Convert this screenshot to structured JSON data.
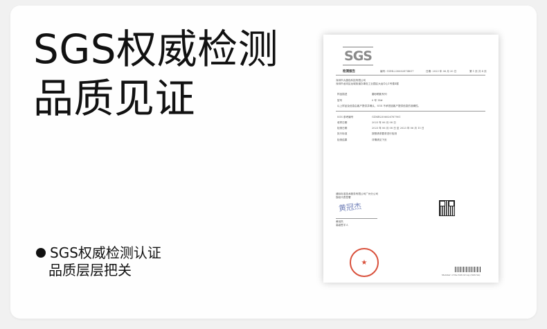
{
  "headline": {
    "line1": "SGS权威检测",
    "line2": "品质见证"
  },
  "features": {
    "line1": "SGS权威检测认证",
    "line2": "品质层层把关"
  },
  "certificate": {
    "logo_text": "SGS",
    "report_title": "检测报告",
    "report_no": "编号: GZHL2306028748O7",
    "date": "日期: 2023 年 06 月 20 日",
    "page": "第 1 页 共 4 页",
    "client_line1": "深圳市大魔色科技有限公司",
    "client_line2": "深圳市龙岗区龙城街道办事处工业园区大运中心1号楼4楼",
    "field_sample_name": "样品描述",
    "val_sample_name": "磨砂眼影系列",
    "field_model": "型号",
    "val_model": "0 号 14#",
    "info_line": "以上样品及信息由客户提供并确认，SGS 不承担因客户提供信息的准确性。",
    "field_sgs_no": "SGS 参考编号",
    "val_sgs_no": "GZMR2306026767901",
    "field_receive_date": "收样日期",
    "val_receive_date": "2023 年 06 月 08 日",
    "field_test_date": "检测日期",
    "val_test_date": "2023 年 06 月 08 日 至 2023 年 06 月 15 日",
    "field_standard": "执行标准",
    "val_standard": "按照请求要求进行检测",
    "field_result": "检测结果",
    "val_result": "详情请见下页",
    "lab_line1": "通标标准技术服务有限公司广州分公司",
    "lab_line2": "授权代表签署",
    "signature": "黄冠杰",
    "signer_name": "黄冠杰",
    "signer_title": "高级签字人",
    "seal_text": "★",
    "footer_note": "Member of the SGS Group (SGS SA)"
  }
}
